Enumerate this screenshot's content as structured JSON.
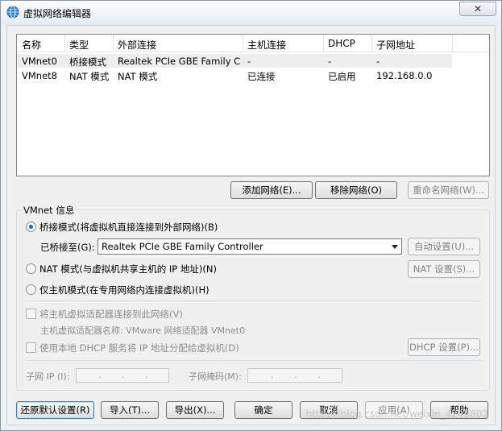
{
  "window": {
    "title": "虚拟网络编辑器",
    "close_glyph": "✕"
  },
  "table": {
    "headers": [
      "名称",
      "类型",
      "外部连接",
      "主机连接",
      "DHCP",
      "子网地址"
    ],
    "rows": [
      [
        "VMnet0",
        "桥接模式",
        "Realtek PCIe GBE Family Co...",
        "-",
        "-",
        "-"
      ],
      [
        "VMnet8",
        "NAT 模式",
        "NAT 模式",
        "已连接",
        "已启用",
        "192.168.0.0"
      ]
    ]
  },
  "network_buttons": {
    "add": "添加网络(E)...",
    "remove": "移除网络(O)",
    "rename": "重命名网络(W)..."
  },
  "vmnet_info": {
    "group_label": "VMnet 信息",
    "bridged_label": "桥接模式(将虚拟机直接连接到外部网络)(B)",
    "bridged_to_label": "已桥接至(G):",
    "bridged_to_value": "Realtek PCIe GBE Family Controller",
    "auto_settings": "自动设置(U)...",
    "nat_label": "NAT 模式(与虚拟机共享主机的 IP 地址)(N)",
    "nat_settings": "NAT 设置(S)...",
    "host_only_label": "仅主机模式(在专用网络内连接虚拟机)(H)",
    "connect_adapter_label": "将主机虚拟适配器连接到此网络(V)",
    "adapter_name_label": "主机虚拟适配器名称: VMware 网络适配器 VMnet0",
    "dhcp_label": "使用本地 DHCP 服务将 IP 地址分配给虚拟机(D)",
    "dhcp_settings": "DHCP 设置(P)...",
    "subnet_ip_label": "子网 IP (I):",
    "subnet_mask_label": "子网掩码(M):",
    "ip_dot": "."
  },
  "bottom_buttons": {
    "restore": "还原默认设置(R)",
    "import": "导入(T)...",
    "export": "导出(X)...",
    "ok": "确定",
    "cancel": "取消",
    "apply": "应用(A)",
    "help": "帮助"
  },
  "watermark": "https://blog.csdn.net/weixin_4243802"
}
